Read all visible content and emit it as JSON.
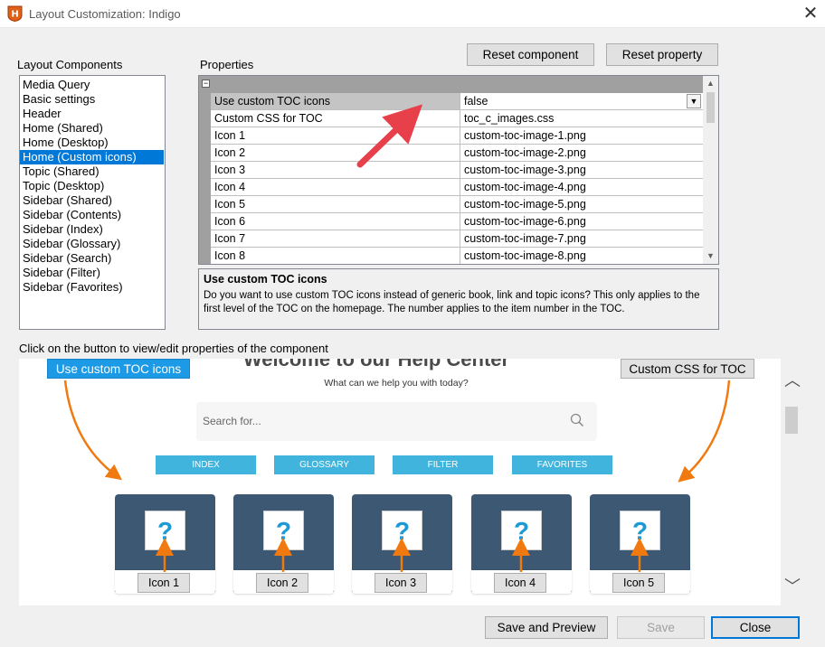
{
  "window": {
    "title": "Layout Customization: Indigo"
  },
  "labels": {
    "layout_components": "Layout Components",
    "properties": "Properties",
    "hint": "Click on the button to view/edit properties of the component"
  },
  "buttons": {
    "reset_component": "Reset component",
    "reset_property": "Reset property",
    "save_and_preview": "Save and Preview",
    "save": "Save",
    "close": "Close"
  },
  "components": [
    "Media Query",
    "Basic settings",
    "Header",
    "Home (Shared)",
    "Home (Desktop)",
    "Home (Custom icons)",
    "Topic (Shared)",
    "Topic (Desktop)",
    "Sidebar (Shared)",
    "Sidebar (Contents)",
    "Sidebar (Index)",
    "Sidebar (Glossary)",
    "Sidebar (Search)",
    "Sidebar (Filter)",
    "Sidebar (Favorites)"
  ],
  "selected_component": "Home (Custom icons)",
  "properties": [
    {
      "name": "Use custom TOC icons",
      "value": "false"
    },
    {
      "name": "Custom CSS for TOC",
      "value": "toc_c_images.css"
    },
    {
      "name": "Icon 1",
      "value": "custom-toc-image-1.png"
    },
    {
      "name": "Icon 2",
      "value": "custom-toc-image-2.png"
    },
    {
      "name": "Icon 3",
      "value": "custom-toc-image-3.png"
    },
    {
      "name": "Icon 4",
      "value": "custom-toc-image-4.png"
    },
    {
      "name": "Icon 5",
      "value": "custom-toc-image-5.png"
    },
    {
      "name": "Icon 6",
      "value": "custom-toc-image-6.png"
    },
    {
      "name": "Icon 7",
      "value": "custom-toc-image-7.png"
    },
    {
      "name": "Icon 8",
      "value": "custom-toc-image-8.png"
    }
  ],
  "description": {
    "title": "Use custom TOC icons",
    "text": "Do you want to use custom TOC icons instead of generic book, link and topic icons? This only applies to the first level of the TOC on the homepage. The number applies to the item number in the TOC."
  },
  "preview": {
    "title": "Welcome to our Help Center",
    "subtitle": "What can we help you with today?",
    "search_placeholder": "Search for...",
    "nav": [
      "INDEX",
      "GLOSSARY",
      "FILTER",
      "FAVORITES"
    ],
    "question_mark": "?",
    "component_buttons": {
      "use_custom_toc_icons": "Use custom TOC icons",
      "custom_css_for_toc": "Custom CSS for TOC"
    },
    "icon_buttons": [
      "Icon 1",
      "Icon 2",
      "Icon 3",
      "Icon 4",
      "Icon 5"
    ]
  },
  "colors": {
    "accent": "#0078d7",
    "nav_button": "#40b4dc",
    "tile": "#3d5873",
    "callout_arrow": "#e8404a",
    "flow_arrow": "#f07a10"
  }
}
